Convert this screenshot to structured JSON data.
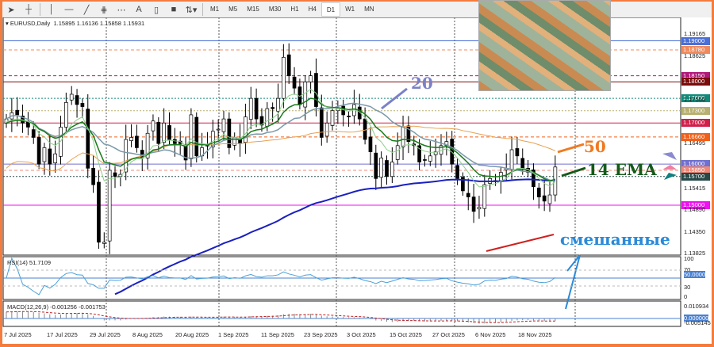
{
  "toolbar": {
    "tools": [
      "cursor-icon",
      "crosshair-icon",
      "vertical-line-icon",
      "horizontal-line-icon",
      "trendline-icon",
      "fibonacci-icon",
      "grid-icon",
      "text-icon",
      "text-label-icon",
      "rectangle-icon",
      "arrows-icon"
    ],
    "text_tool": "A",
    "timeframes": [
      "M1",
      "M5",
      "M15",
      "M30",
      "H1",
      "H4",
      "D1",
      "W1",
      "MN"
    ],
    "active_timeframe": "D1"
  },
  "chart": {
    "symbol": "EURUSD,Daily",
    "ohlc": "1.15895 1.16136 1.15858 1.15931",
    "price_ticks": [
      "1.19165",
      "1.18625",
      "1.17560",
      "1.16495",
      "1.15415",
      "1.14890",
      "1.14350",
      "1.13825"
    ],
    "levels": [
      {
        "price": 1.19,
        "label": "1.19000",
        "color": "#4a6fd6",
        "style": "solid"
      },
      {
        "price": 1.1878,
        "label": "1.18780",
        "color": "#f08a5d",
        "style": "dash"
      },
      {
        "price": 1.1815,
        "label": "1.18150",
        "color": "#b0187a",
        "style": "dash"
      },
      {
        "price": 1.18,
        "label": "1.18000",
        "color": "#7a0c0c",
        "style": "solid"
      },
      {
        "price": 1.176,
        "label": "1.17600",
        "color": "#128a7a",
        "style": "dot"
      },
      {
        "price": 1.173,
        "label": "1.17300",
        "color": "#b8b070",
        "style": "dot"
      },
      {
        "price": 1.17,
        "label": "1.17000",
        "color": "#d0204a",
        "style": "solid"
      },
      {
        "price": 1.1666,
        "label": "1.16660",
        "color": "#f0601a",
        "style": "dash"
      },
      {
        "price": 1.16,
        "label": "1.16000",
        "color": "#7070d0",
        "style": "solid"
      },
      {
        "price": 1.1585,
        "label": "1.15850",
        "color": "#f08878",
        "style": "dash"
      },
      {
        "price": 1.157,
        "label": "1.15700",
        "color": "#284848",
        "style": "dot"
      },
      {
        "price": 1.15,
        "label": "1.15000",
        "color": "#f010f0",
        "style": "solid"
      }
    ],
    "closes": [
      1.171,
      1.1725,
      1.172,
      1.17,
      1.169,
      1.1665,
      1.16,
      1.164,
      1.16,
      1.1625,
      1.169,
      1.175,
      1.177,
      1.1745,
      1.174,
      1.159,
      1.155,
      1.141,
      1.141,
      1.1585,
      1.157,
      1.1575,
      1.166,
      1.1665,
      1.164,
      1.1615,
      1.1675,
      1.1705,
      1.165,
      1.17,
      1.166,
      1.165,
      1.165,
      1.161,
      1.172,
      1.162,
      1.164,
      1.1645,
      1.168,
      1.1685,
      1.171,
      1.164,
      1.1665,
      1.165,
      1.1715,
      1.176,
      1.171,
      1.1695,
      1.1735,
      1.1735,
      1.176,
      1.186,
      1.1815,
      1.1785,
      1.1745,
      1.18,
      1.1815,
      1.174,
      1.1665,
      1.17,
      1.173,
      1.1735,
      1.172,
      1.1715,
      1.1745,
      1.171,
      1.166,
      1.163,
      1.1565,
      1.1615,
      1.157,
      1.1605,
      1.1645,
      1.169,
      1.1655,
      1.1645,
      1.1605,
      1.161,
      1.162,
      1.163,
      1.1645,
      1.1655,
      1.16,
      1.1565,
      1.1535,
      1.152,
      1.1485,
      1.1495,
      1.155,
      1.1565,
      1.156,
      1.158,
      1.159,
      1.1635,
      1.162,
      1.159,
      1.158,
      1.1545,
      1.152,
      1.151,
      1.1525,
      1.1593
    ]
  },
  "rsi": {
    "label": "RSI(14) 51.7109",
    "ticks": [
      "100",
      "70",
      "50.0000",
      "30",
      "0"
    ]
  },
  "macd": {
    "label": "MACD(12,26,9) -0.001256 -0.001753",
    "ticks": [
      "0.010934",
      "0.000000",
      "-0.005145"
    ]
  },
  "dates": [
    "7 Jul 2025",
    "17 Jul 2025",
    "29 Jul 2025",
    "8 Aug 2025",
    "20 Aug 2025",
    "1 Sep 2025",
    "11 Sep 2025",
    "23 Sep 2025",
    "3 Oct 2025",
    "15 Oct 2025",
    "27 Oct 2025",
    "6 Nov 2025",
    "18 Nov 2025"
  ],
  "annotations": {
    "ma20": "20",
    "ma50": "50",
    "ema14": "14 EMA",
    "mixed": "смешанные"
  },
  "colors": {
    "border": "#f47c3c",
    "ema14": "#1a7a1a",
    "ma20": "#7a9aaa",
    "ma50": "#e8a050",
    "ma_blue": "#1a20c0"
  }
}
